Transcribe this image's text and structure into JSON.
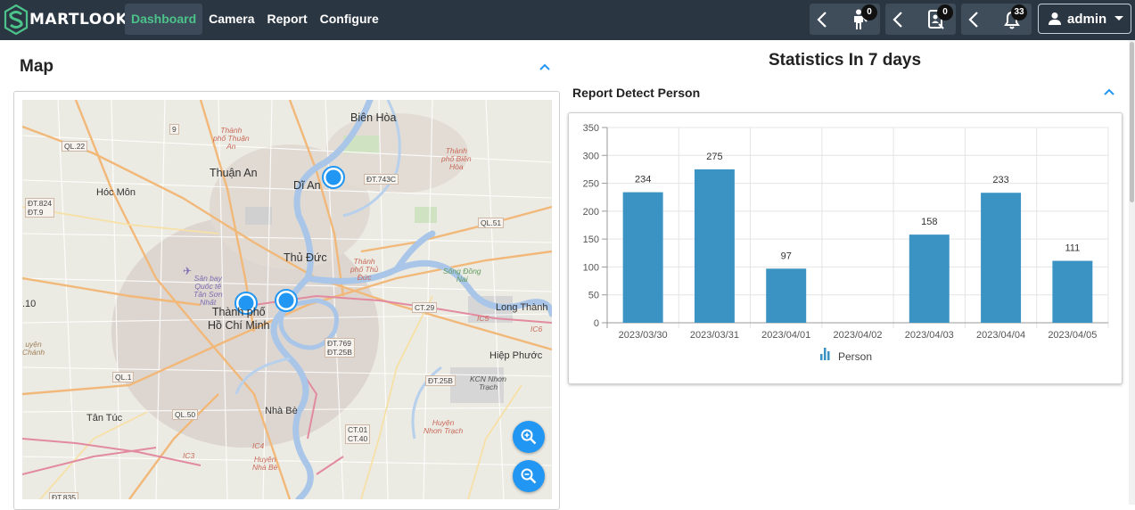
{
  "header": {
    "logo_first": "S",
    "logo_mid": "MART",
    "logo_end": "LOOK",
    "nav": [
      {
        "label": "Dashboard",
        "active": true
      },
      {
        "label": "Camera",
        "active": false
      },
      {
        "label": "Report",
        "active": false
      },
      {
        "label": "Configure",
        "active": false
      }
    ],
    "notifications": [
      {
        "icon": "person-icon",
        "count": "0"
      },
      {
        "icon": "id-card-icon",
        "count": "0"
      },
      {
        "icon": "bell-icon",
        "count": "33"
      }
    ],
    "user": {
      "label": "admin",
      "icon": "user-icon",
      "caret": "caret-down-icon"
    }
  },
  "map_panel": {
    "title": "Map",
    "labels": {
      "bien_hoa": "Biên Hòa",
      "ql22": "QL.22",
      "thuan_an": "Thuận An",
      "di_an": "Dĩ An",
      "hoc_mon": "Hóc Môn",
      "dt824": "ĐT.824\nĐT.9",
      "ql51": "QL.51",
      "thu_duc": "Thủ Đức",
      "l10": ".10",
      "thanh_pho": "Thành phố\nHồ Chí Minh",
      "ct29": "CT.29",
      "long_thanh": "Long Thành",
      "dt769": "ĐT.769\nĐT.25B",
      "hiep_phuoc": "Hiệp Phước",
      "ql1": "QL.1",
      "dt25b": "ĐT.25B",
      "tan_tuc": "Tân Túc",
      "ql50": "QL.50",
      "nha_be": "Nhà Bè",
      "ct01": "CT.01\nCT.40",
      "dt743c": "ĐT.743C",
      "dt835": "ĐT.835",
      "san_bay": "Sân bay\nQuốc tế\nTân Sơn\nNhất",
      "huyen_chanh": "uyện\nChánh",
      "huyen_nhon": "Huyện\nNhơn Trạch",
      "kcn": "KCN Nhơn\nTrạch",
      "song_dong": "Sông Đồng\nNai",
      "tp_thu_duc": "Thành\nphố Thủ\nĐức",
      "tp_bien_hoa": "Thành\nphố Biên\nHòa",
      "tp_thuan": "Thành\nphố Thuận\nAn",
      "huyen_nha_be": "Huyện\nNhà Bè",
      "n9": "9",
      "ic3": "IC3",
      "ic4": "IC4",
      "ic5": "IC5",
      "ic6": "IC6"
    },
    "markers": 3,
    "zoom_in_icon": "zoom-in-icon",
    "zoom_out_icon": "zoom-out-icon"
  },
  "stats_panel": {
    "title": "Statistics In 7 days",
    "report_title": "Report Detect Person"
  },
  "chart_data": {
    "type": "bar",
    "title": "",
    "categories": [
      "2023/03/30",
      "2023/03/31",
      "2023/04/01",
      "2023/04/02",
      "2023/04/03",
      "2023/04/04",
      "2023/04/05"
    ],
    "series": [
      {
        "name": "Person",
        "values": [
          234,
          275,
          97,
          0,
          158,
          233,
          111
        ],
        "color": "#3a93c3"
      }
    ],
    "data_labels": [
      "234",
      "275",
      "97",
      "",
      "158",
      "233",
      "111"
    ],
    "ylim": [
      0,
      350
    ],
    "yticks": [
      0,
      50,
      100,
      150,
      200,
      250,
      300,
      350
    ],
    "grid": true,
    "legend": "bottom-center"
  },
  "colors": {
    "header_bg": "#2b3643",
    "accent_green": "#4cc38a",
    "bar": "#3a93c3",
    "zoom_button": "#2196f3"
  }
}
